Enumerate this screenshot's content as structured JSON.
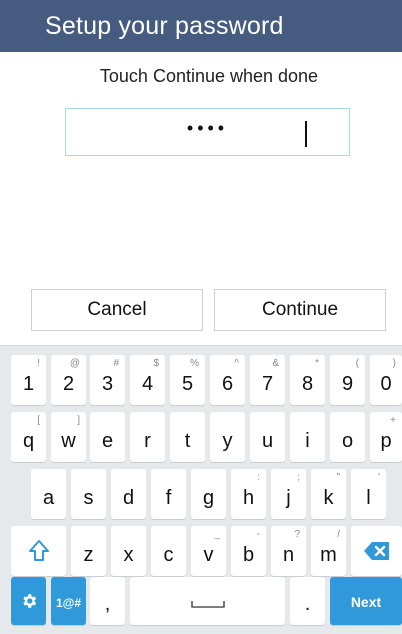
{
  "header": {
    "title": "Setup your password"
  },
  "prompt": "Touch Continue when done",
  "password": {
    "masked": "••••"
  },
  "buttons": {
    "cancel": "Cancel",
    "continue": "Continue"
  },
  "keyboard": {
    "row1": [
      {
        "main": "1",
        "sub": "!"
      },
      {
        "main": "2",
        "sub": "@"
      },
      {
        "main": "3",
        "sub": "#"
      },
      {
        "main": "4",
        "sub": "$"
      },
      {
        "main": "5",
        "sub": "%"
      },
      {
        "main": "6",
        "sub": "^"
      },
      {
        "main": "7",
        "sub": "&"
      },
      {
        "main": "8",
        "sub": "*"
      },
      {
        "main": "9",
        "sub": "("
      },
      {
        "main": "0",
        "sub": ")"
      }
    ],
    "row2": [
      {
        "main": "q",
        "sub": "["
      },
      {
        "main": "w",
        "sub": "]"
      },
      {
        "main": "e",
        "sub": ""
      },
      {
        "main": "r",
        "sub": ""
      },
      {
        "main": "t",
        "sub": ""
      },
      {
        "main": "y",
        "sub": ""
      },
      {
        "main": "u",
        "sub": ""
      },
      {
        "main": "i",
        "sub": ""
      },
      {
        "main": "o",
        "sub": ""
      },
      {
        "main": "p",
        "sub": "+"
      }
    ],
    "row3": [
      {
        "main": "a",
        "sub": ""
      },
      {
        "main": "s",
        "sub": ""
      },
      {
        "main": "d",
        "sub": ""
      },
      {
        "main": "f",
        "sub": ""
      },
      {
        "main": "g",
        "sub": ""
      },
      {
        "main": "h",
        "sub": ":"
      },
      {
        "main": "j",
        "sub": ";"
      },
      {
        "main": "k",
        "sub": "\""
      },
      {
        "main": "l",
        "sub": "'"
      }
    ],
    "row4": [
      {
        "main": "z",
        "sub": ""
      },
      {
        "main": "x",
        "sub": ""
      },
      {
        "main": "c",
        "sub": ""
      },
      {
        "main": "v",
        "sub": "_"
      },
      {
        "main": "b",
        "sub": "-"
      },
      {
        "main": "n",
        "sub": "?"
      },
      {
        "main": "m",
        "sub": "/"
      }
    ],
    "symbols_label": "1@#",
    "comma": ",",
    "period": ".",
    "next_label": "Next"
  },
  "colors": {
    "header_bg": "#455b80",
    "accent": "#2f99d9",
    "field_border": "#a7d8e6"
  }
}
